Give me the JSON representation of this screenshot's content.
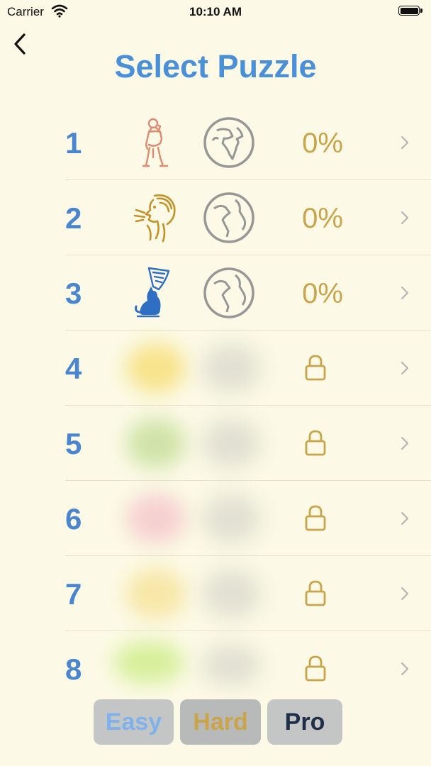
{
  "status_bar": {
    "carrier": "Carrier",
    "time": "10:10 AM"
  },
  "nav": {
    "title": "Select Puzzle",
    "back_icon": "chevron-left-icon"
  },
  "puzzles": [
    {
      "number": "1",
      "progress": "0%",
      "locked": false,
      "art": "statue-icon",
      "art_color": "#e08a70"
    },
    {
      "number": "2",
      "progress": "0%",
      "locked": false,
      "art": "face-sketch-icon",
      "art_color": "#c4922a"
    },
    {
      "number": "3",
      "progress": "0%",
      "locked": false,
      "art": "sphinx-cat-icon",
      "art_color": "#2e6fc4"
    },
    {
      "number": "4",
      "locked": true,
      "preview_color": "#f7e38a"
    },
    {
      "number": "5",
      "locked": true,
      "preview_color": "#cfe3a8"
    },
    {
      "number": "6",
      "locked": true,
      "preview_color": "#f6cfd0"
    },
    {
      "number": "7",
      "locked": true,
      "preview_color": "#f7e6a6"
    },
    {
      "number": "8",
      "locked": true,
      "preview_color": "#d6ef9a"
    }
  ],
  "difficulty": {
    "easy": "Easy",
    "hard": "Hard",
    "pro": "Pro",
    "colors": {
      "easy": "#7fb1ec",
      "hard": "#c9a44a",
      "pro": "#1f2f4a",
      "button_bg": "#c4c6c5"
    }
  },
  "colors": {
    "accent": "#4a90d9",
    "number": "#4a86cf",
    "gold": "#c9a44a",
    "background": "#fcfae6"
  }
}
